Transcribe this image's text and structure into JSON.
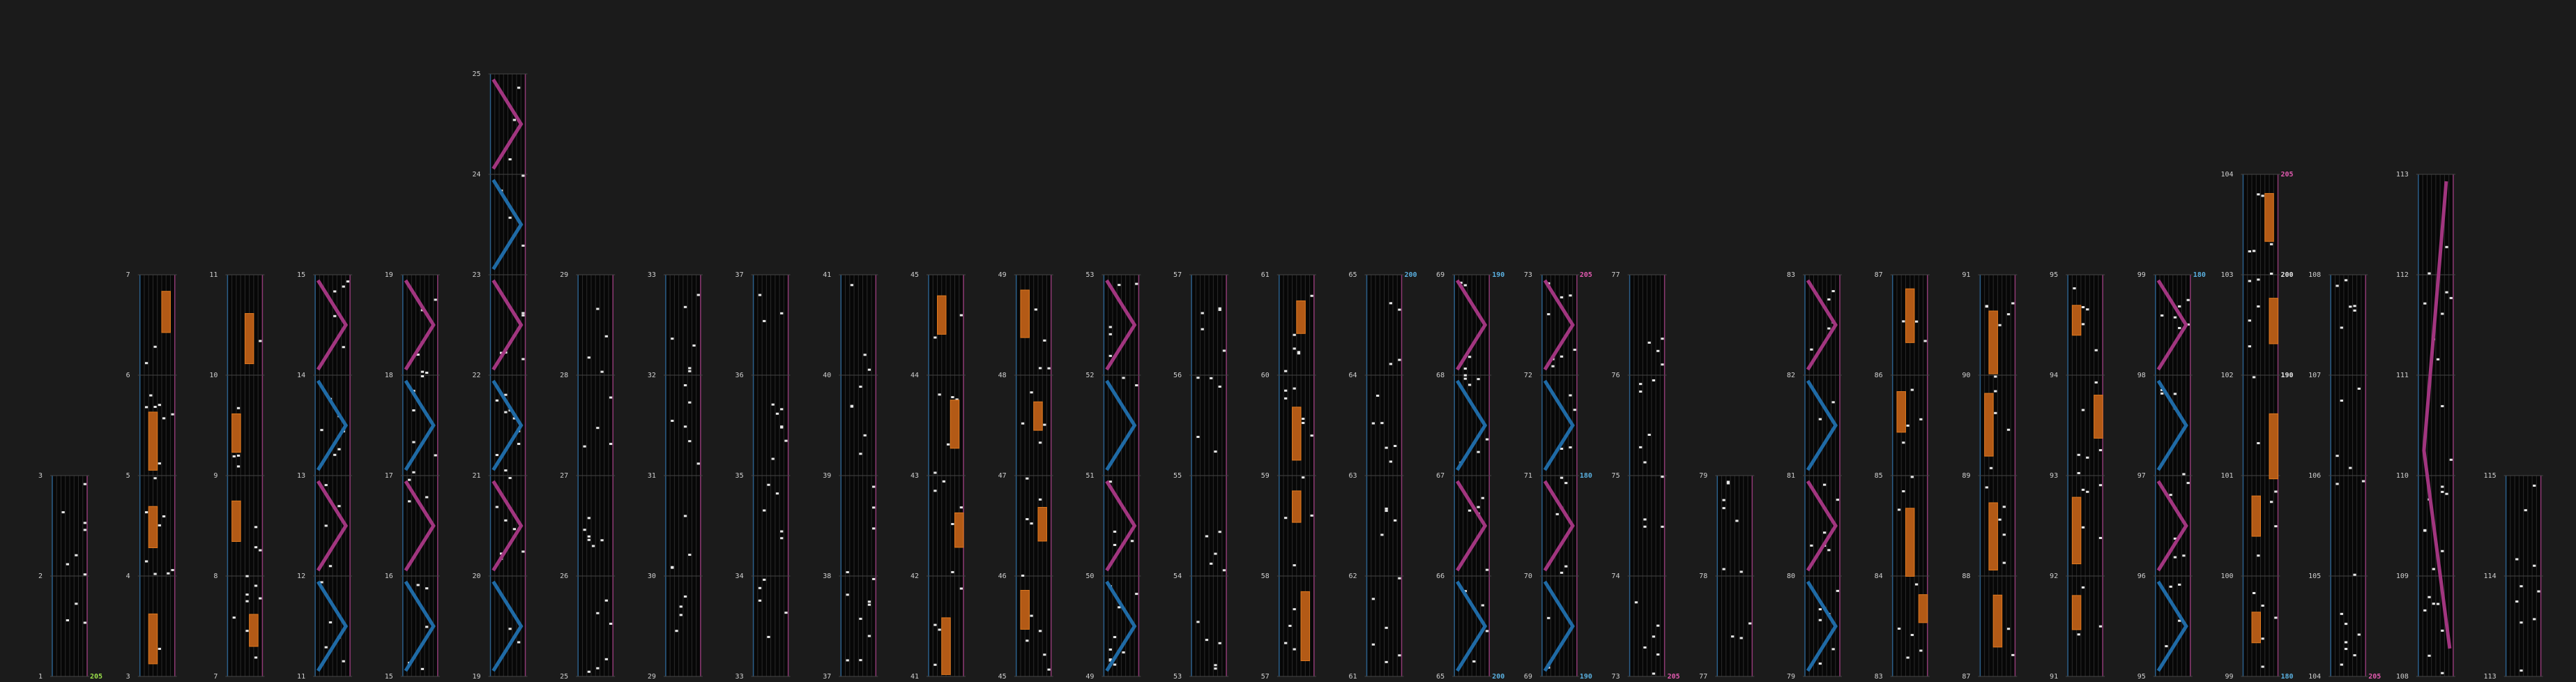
{
  "app": {
    "title": ""
  },
  "colors": {
    "background": "#1b1b1b",
    "column": "#070707",
    "note": "#e8e8e8",
    "hold": "#b35a16",
    "hold_edge": "#e07a20",
    "scratch_blue": "#1f6aa5",
    "scratch_pink": "#a1357f",
    "bpm_green": "#9be04a",
    "bpm_pink": "#e25ab0",
    "bpm_blue": "#5ab0e0"
  },
  "chart_columns": [
    {
      "name": "col-1",
      "measures": [
        "1",
        "2",
        "3"
      ],
      "bpm_labels": [
        {
          "measure": 0,
          "text": "205",
          "color": "green"
        }
      ]
    },
    {
      "name": "col-2",
      "measures": [
        "3",
        "4",
        "5",
        "6",
        "7"
      ]
    },
    {
      "name": "col-3",
      "measures": [
        "7",
        "8",
        "9",
        "10",
        "11"
      ]
    },
    {
      "name": "col-4",
      "measures": [
        "11",
        "12",
        "13",
        "14",
        "15"
      ]
    },
    {
      "name": "col-5",
      "measures": [
        "15",
        "16",
        "17",
        "18",
        "19"
      ]
    },
    {
      "name": "col-6",
      "measures": [
        "19",
        "20",
        "21",
        "22",
        "23",
        "24",
        "25"
      ]
    },
    {
      "name": "col-7",
      "measures": [
        "25",
        "26",
        "27",
        "28",
        "29"
      ]
    },
    {
      "name": "col-8",
      "measures": [
        "29",
        "30",
        "31",
        "32",
        "33"
      ]
    },
    {
      "name": "col-9",
      "measures": [
        "33",
        "34",
        "35",
        "36",
        "37"
      ]
    },
    {
      "name": "col-10",
      "measures": [
        "37",
        "38",
        "39",
        "40",
        "41"
      ]
    },
    {
      "name": "col-11",
      "measures": [
        "41",
        "42",
        "43",
        "44",
        "45"
      ]
    },
    {
      "name": "col-12",
      "measures": [
        "45",
        "46",
        "47",
        "48",
        "49"
      ]
    },
    {
      "name": "col-13",
      "measures": [
        "49",
        "50",
        "51",
        "52",
        "53"
      ]
    },
    {
      "name": "col-14",
      "measures": [
        "53",
        "54",
        "55",
        "56",
        "57"
      ]
    },
    {
      "name": "col-15",
      "measures": [
        "57",
        "58",
        "59",
        "60",
        "61"
      ]
    },
    {
      "name": "col-16",
      "measures": [
        "61",
        "62",
        "63",
        "64",
        "65"
      ],
      "bpm_labels": [
        {
          "measure": 4,
          "text": "200",
          "color": "blue"
        }
      ]
    },
    {
      "name": "col-17",
      "measures": [
        "65",
        "66",
        "67",
        "68",
        "69"
      ],
      "bpm_labels": [
        {
          "measure": 0,
          "text": "200",
          "color": "blue"
        },
        {
          "measure": 4,
          "text": "190",
          "color": "blue"
        }
      ]
    },
    {
      "name": "col-18",
      "measures": [
        "69",
        "70",
        "71",
        "72",
        "73"
      ],
      "bpm_labels": [
        {
          "measure": 0,
          "text": "190",
          "color": "blue"
        },
        {
          "measure": 2,
          "text": "180",
          "color": "blue"
        },
        {
          "measure": 4,
          "text": "205",
          "color": "pink"
        }
      ]
    },
    {
      "name": "col-19",
      "measures": [
        "73",
        "74",
        "75",
        "76",
        "77"
      ],
      "bpm_labels": [
        {
          "measure": 0,
          "text": "205",
          "color": "pink"
        }
      ]
    },
    {
      "name": "col-20",
      "measures": [
        "77",
        "78",
        "79"
      ]
    },
    {
      "name": "col-21",
      "measures": [
        "79",
        "80",
        "81",
        "82",
        "83"
      ]
    },
    {
      "name": "col-22",
      "measures": [
        "83",
        "84",
        "85",
        "86",
        "87"
      ]
    },
    {
      "name": "col-23",
      "measures": [
        "87",
        "88",
        "89",
        "90",
        "91"
      ]
    },
    {
      "name": "col-24",
      "measures": [
        "91",
        "92",
        "93",
        "94",
        "95"
      ]
    },
    {
      "name": "col-25",
      "measures": [
        "95",
        "96",
        "97",
        "98",
        "99"
      ],
      "bpm_labels": [
        {
          "measure": 4,
          "text": "180",
          "color": "blue"
        }
      ]
    },
    {
      "name": "col-26",
      "measures": [
        "99",
        "100",
        "101",
        "102",
        "103",
        "104"
      ],
      "bpm_labels": [
        {
          "measure": 0,
          "text": "180",
          "color": "blue"
        },
        {
          "measure": 3,
          "text": "190",
          "color": "white"
        },
        {
          "measure": 4,
          "text": "200",
          "color": "white"
        },
        {
          "measure": 5,
          "text": "205",
          "color": "pink"
        }
      ]
    },
    {
      "name": "col-27",
      "measures": [
        "104",
        "105",
        "106",
        "107",
        "108"
      ],
      "bpm_labels": [
        {
          "measure": 0,
          "text": "205",
          "color": "pink"
        }
      ]
    },
    {
      "name": "col-28",
      "measures": [
        "108",
        "109",
        "110",
        "111",
        "112",
        "113"
      ]
    },
    {
      "name": "col-29",
      "measures": [
        "113",
        "114",
        "115"
      ]
    }
  ]
}
